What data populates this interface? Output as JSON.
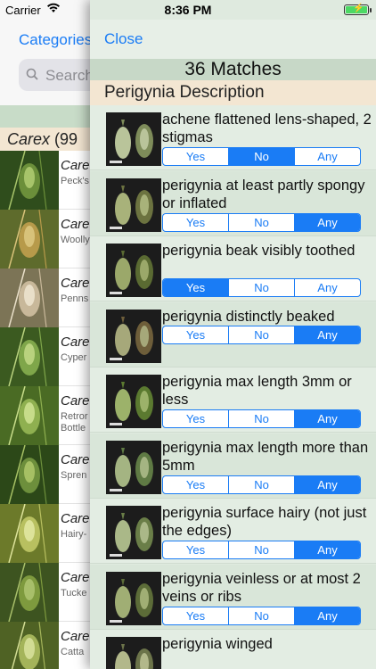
{
  "status_bar": {
    "carrier": "Carrier",
    "time": "8:36 PM"
  },
  "back_panel": {
    "categories_label": "Categories",
    "search_placeholder": "Search",
    "genus_header": {
      "genus": "Carex",
      "count": "(99"
    },
    "species": [
      {
        "name": "Care",
        "common": "Peck's"
      },
      {
        "name": "Care",
        "common": "Woolly"
      },
      {
        "name": "Care",
        "common": "Penns"
      },
      {
        "name": "Care",
        "common": "Cyper"
      },
      {
        "name": "Care",
        "common": "Retror\nBottle"
      },
      {
        "name": "Care",
        "common": "Spren"
      },
      {
        "name": "Care",
        "common": "Hairy-"
      },
      {
        "name": "Care",
        "common": "Tucke"
      },
      {
        "name": "Care",
        "common": "Catta"
      }
    ]
  },
  "modal": {
    "close_label": "Close",
    "matches_label": "36 Matches",
    "section_title": "Perigynia Description",
    "segment_labels": [
      "Yes",
      "No",
      "Any"
    ],
    "traits": [
      {
        "label": "achene flattened lens-shaped, 2 stigmas",
        "selected": "No"
      },
      {
        "label": "perigynia at least partly spongy or inflated",
        "selected": "Any"
      },
      {
        "label": "perigynia beak visibly toothed",
        "selected": "Yes"
      },
      {
        "label": "perigynia distinctly beaked",
        "selected": "Any"
      },
      {
        "label": "perigynia max length 3mm or less",
        "selected": "Any"
      },
      {
        "label": "perigynia max length more than 5mm",
        "selected": "Any"
      },
      {
        "label": "perigynia surface hairy (not just the edges)",
        "selected": "Any"
      },
      {
        "label": "perigynia veinless or at most 2 veins or ribs",
        "selected": "Any"
      },
      {
        "label": "perigynia winged",
        "selected": "Any"
      }
    ]
  },
  "colors": {
    "accent": "#1a7cf5",
    "matches_bg": "#c7d8c7",
    "section_bg": "#f3e6d2"
  }
}
